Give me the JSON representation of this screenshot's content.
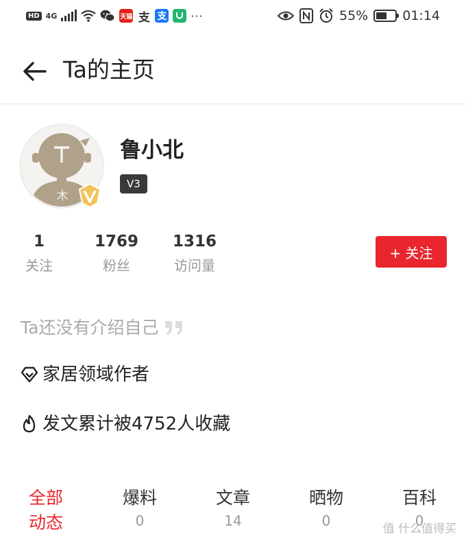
{
  "status_bar": {
    "hd": "HD",
    "network": "4G",
    "battery_percent": "55%",
    "battery_level": 0.55,
    "time": "01:14",
    "app_icons": [
      "wechat-icon",
      "tmall-icon",
      "alipay-icon",
      "alipay-icon",
      "security-icon"
    ],
    "tmall_label": "天猫",
    "alipay_label": "支",
    "more": "···"
  },
  "header": {
    "title": "Ta的主页"
  },
  "profile": {
    "username": "鲁小北",
    "level": "V3",
    "avatar_char": "木"
  },
  "stats": [
    {
      "value": "1",
      "label": "关注"
    },
    {
      "value": "1769",
      "label": "粉丝"
    },
    {
      "value": "1316",
      "label": "访问量"
    }
  ],
  "follow_button": "+ 关注",
  "intro_text": "Ta还没有介绍自己",
  "info_rows": [
    {
      "icon": "diamond-icon",
      "text": "家居领域作者"
    },
    {
      "icon": "flame-icon",
      "text": "发文累计被4752人收藏"
    }
  ],
  "tabs": {
    "active": {
      "label_line1": "全部",
      "label_line2": "动态"
    },
    "items": [
      {
        "label": "爆料",
        "count": "0"
      },
      {
        "label": "文章",
        "count": "14"
      },
      {
        "label": "晒物",
        "count": "0"
      },
      {
        "label": "百科",
        "count": "0"
      }
    ]
  },
  "watermark": "值 什么值得买",
  "colors": {
    "accent": "#e9262e",
    "badge_dark": "#3a3a3a",
    "avatar_brown": "#b0a18a",
    "v_gold": "#f2c35a"
  }
}
